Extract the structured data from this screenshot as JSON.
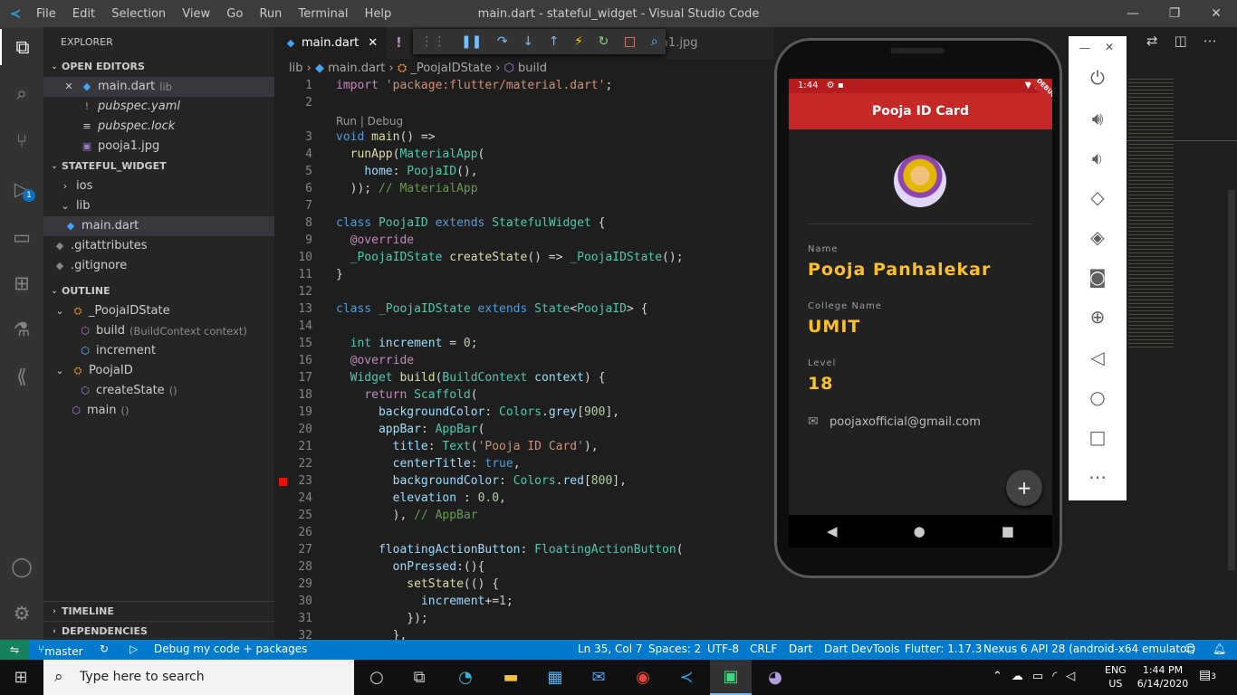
{
  "window": {
    "title": "main.dart - stateful_widget - Visual Studio Code",
    "menu": [
      "File",
      "Edit",
      "Selection",
      "View",
      "Go",
      "Run",
      "Terminal",
      "Help"
    ]
  },
  "explorer": {
    "title": "EXPLORER",
    "open_editors": {
      "label": "OPEN EDITORS",
      "items": [
        {
          "name": "main.dart",
          "hint": "lib"
        },
        {
          "name": "pubspec.yaml"
        },
        {
          "name": "pubspec.lock"
        },
        {
          "name": "pooja1.jpg"
        }
      ]
    },
    "project": {
      "label": "STATEFUL_WIDGET",
      "items": [
        "ios",
        "lib",
        "main.dart",
        ".gitattributes",
        ".gitignore"
      ]
    },
    "outline": {
      "label": "OUTLINE",
      "items": [
        {
          "name": "_PoojaIDState"
        },
        {
          "name": "build",
          "hint": "(BuildContext context)"
        },
        {
          "name": "increment"
        },
        {
          "name": "PoojaID"
        },
        {
          "name": "createState",
          "hint": "()"
        },
        {
          "name": "main",
          "hint": "()"
        }
      ]
    },
    "timeline": "TIMELINE",
    "dependencies": "DEPENDENCIES"
  },
  "tabs": [
    {
      "label": "main.dart"
    },
    {
      "label": "pooja1.jpg"
    }
  ],
  "breadcrumb": {
    "root": "lib",
    "file": "main.dart",
    "cls": "_PoojaIDState",
    "method": "build"
  },
  "code": {
    "codelens": "Run | Debug"
  },
  "app": {
    "status_time": "1:44",
    "appbar_title": "Pooja ID Card",
    "name_label": "Name",
    "name": "Pooja Panhalekar",
    "college_label": "College Name",
    "college": "UMIT",
    "level_label": "Level",
    "level": "18",
    "email": "poojaxofficial@gmail.com",
    "fab": "+"
  },
  "statusbar": {
    "branch": "master",
    "debug": "Debug my code + packages",
    "position": "Ln 35, Col 7",
    "spaces": "Spaces: 2",
    "encoding": "UTF-8",
    "eol": "CRLF",
    "language": "Dart",
    "devtools": "Dart DevTools",
    "flutter": "Flutter: 1.17.3",
    "device": "Nexus 6 API 28 (android-x64 emulator)"
  },
  "taskbar": {
    "search_placeholder": "Type here to search",
    "lang": "ENG",
    "region": "US",
    "time": "1:44 PM",
    "date": "6/14/2020",
    "notif": "3"
  },
  "colors": {
    "accent": "#007acc",
    "appbar": "#c62828",
    "amber": "#fbc02d"
  }
}
